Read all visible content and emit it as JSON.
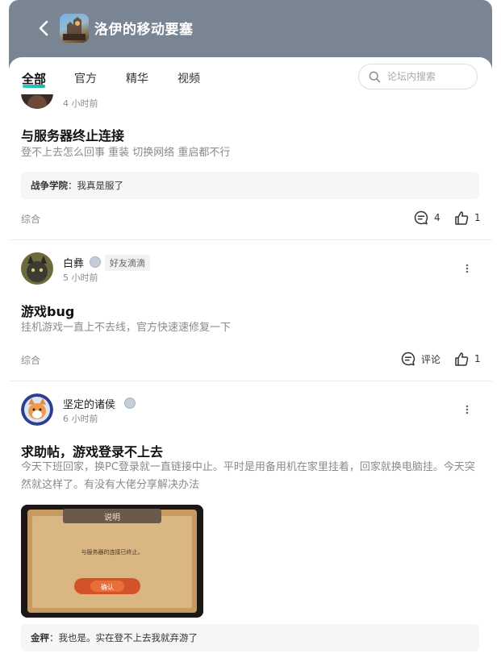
{
  "header": {
    "title": "洛伊的移动要塞"
  },
  "tabs": [
    {
      "label": "全部",
      "active": true
    },
    {
      "label": "官方"
    },
    {
      "label": "精华"
    },
    {
      "label": "视频"
    }
  ],
  "search": {
    "placeholder": "论坛内搜索"
  },
  "posts": [
    {
      "time": "4 小时前",
      "title": "与服务器终止连接",
      "body": "登不上去怎么回事 重装 切换网络 重启都不行",
      "reply": {
        "author": "战争学院",
        "text": "我真是服了"
      },
      "category": "综合",
      "comments": "4",
      "likes": "1"
    },
    {
      "username": "白彝",
      "tag": "好友滴滴",
      "time": "5 小时前",
      "title": "游戏bug",
      "body": "挂机游戏一直上不去线，官方快速速修复一下",
      "category": "综合",
      "comments": "评论",
      "likes": "1"
    },
    {
      "username": "坚定的诸侯",
      "time": "6 小时前",
      "title": "求助帖，游戏登录不上去",
      "body": "今天下班回家，换PC登录就一直链接中止。平时是用备用机在家里挂着，回家就换电脑挂。今天突然就这样了。有没有大佬分享解决办法",
      "image": {
        "dialog_title": "说明",
        "dialog_text": "与服务器的连接已终止。",
        "confirm_label": "确认"
      },
      "reply": {
        "author": "金秤",
        "text": "我也是。实在登不上去我就弃游了"
      }
    }
  ],
  "colors": {
    "header": "#7a8593",
    "accent": "#2ccdc3"
  }
}
